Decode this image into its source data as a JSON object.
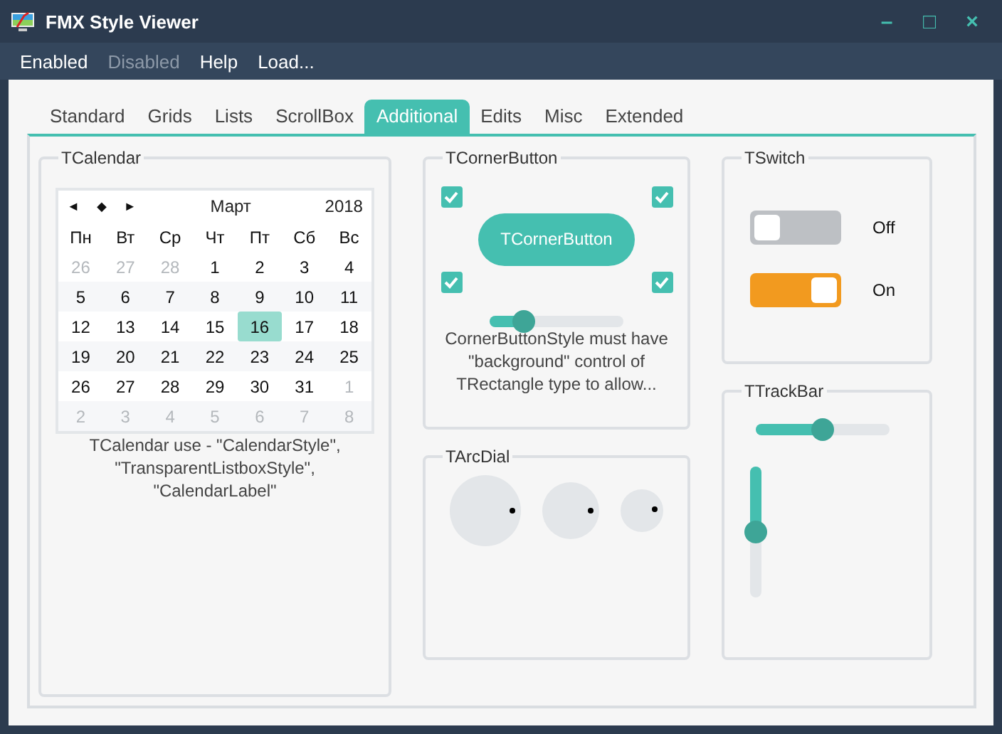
{
  "window": {
    "title": "FMX Style Viewer",
    "controls": [
      "–",
      "□",
      "×"
    ]
  },
  "menu": [
    {
      "label": "Enabled",
      "disabled": false
    },
    {
      "label": "Disabled",
      "disabled": true
    },
    {
      "label": "Help",
      "disabled": false
    },
    {
      "label": "Load...",
      "disabled": false
    }
  ],
  "tabs": [
    {
      "label": "Standard",
      "selected": false
    },
    {
      "label": "Grids",
      "selected": false
    },
    {
      "label": "Lists",
      "selected": false
    },
    {
      "label": "ScrollBox",
      "selected": false
    },
    {
      "label": "Additional",
      "selected": true
    },
    {
      "label": "Edits",
      "selected": false
    },
    {
      "label": "Misc",
      "selected": false
    },
    {
      "label": "Extended",
      "selected": false
    }
  ],
  "calendar": {
    "title": "TCalendar",
    "nav": [
      "◄",
      "◆",
      "►"
    ],
    "month": "Март",
    "year": "2018",
    "weekdays": [
      "Пн",
      "Вт",
      "Ср",
      "Чт",
      "Пт",
      "Сб",
      "Вс"
    ],
    "weeks": [
      [
        {
          "day": "26",
          "muted": true,
          "selected": false
        },
        {
          "day": "27",
          "muted": true,
          "selected": false
        },
        {
          "day": "28",
          "muted": true,
          "selected": false
        },
        {
          "day": "1",
          "muted": false,
          "selected": false
        },
        {
          "day": "2",
          "muted": false,
          "selected": false
        },
        {
          "day": "3",
          "muted": false,
          "selected": false
        },
        {
          "day": "4",
          "muted": false,
          "selected": false
        }
      ],
      [
        {
          "day": "5",
          "muted": false,
          "selected": false
        },
        {
          "day": "6",
          "muted": false,
          "selected": false
        },
        {
          "day": "7",
          "muted": false,
          "selected": false
        },
        {
          "day": "8",
          "muted": false,
          "selected": false
        },
        {
          "day": "9",
          "muted": false,
          "selected": false
        },
        {
          "day": "10",
          "muted": false,
          "selected": false
        },
        {
          "day": "11",
          "muted": false,
          "selected": false
        }
      ],
      [
        {
          "day": "12",
          "muted": false,
          "selected": false
        },
        {
          "day": "13",
          "muted": false,
          "selected": false
        },
        {
          "day": "14",
          "muted": false,
          "selected": false
        },
        {
          "day": "15",
          "muted": false,
          "selected": false
        },
        {
          "day": "16",
          "muted": false,
          "selected": true
        },
        {
          "day": "17",
          "muted": false,
          "selected": false
        },
        {
          "day": "18",
          "muted": false,
          "selected": false
        }
      ],
      [
        {
          "day": "19",
          "muted": false,
          "selected": false
        },
        {
          "day": "20",
          "muted": false,
          "selected": false
        },
        {
          "day": "21",
          "muted": false,
          "selected": false
        },
        {
          "day": "22",
          "muted": false,
          "selected": false
        },
        {
          "day": "23",
          "muted": false,
          "selected": false
        },
        {
          "day": "24",
          "muted": false,
          "selected": false
        },
        {
          "day": "25",
          "muted": false,
          "selected": false
        }
      ],
      [
        {
          "day": "26",
          "muted": false,
          "selected": false
        },
        {
          "day": "27",
          "muted": false,
          "selected": false
        },
        {
          "day": "28",
          "muted": false,
          "selected": false
        },
        {
          "day": "29",
          "muted": false,
          "selected": false
        },
        {
          "day": "30",
          "muted": false,
          "selected": false
        },
        {
          "day": "31",
          "muted": false,
          "selected": false
        },
        {
          "day": "1",
          "muted": true,
          "selected": false
        }
      ],
      [
        {
          "day": "2",
          "muted": true,
          "selected": false
        },
        {
          "day": "3",
          "muted": true,
          "selected": false
        },
        {
          "day": "4",
          "muted": true,
          "selected": false
        },
        {
          "day": "5",
          "muted": true,
          "selected": false
        },
        {
          "day": "6",
          "muted": true,
          "selected": false
        },
        {
          "day": "7",
          "muted": true,
          "selected": false
        },
        {
          "day": "8",
          "muted": true,
          "selected": false
        }
      ]
    ],
    "note": "TCalendar use - \"CalendarStyle\", \"TransparentListboxStyle\", \"CalendarLabel\""
  },
  "corner_button": {
    "title": "TCornerButton",
    "button": "TCornerButton",
    "corners": [
      {
        "checked": true
      },
      {
        "checked": true
      },
      {
        "checked": true
      },
      {
        "checked": true
      }
    ],
    "slider": {
      "level": 0.25
    },
    "note": "CornerButtonStyle must have \"background\" control of TRectangle type to allow..."
  },
  "arc_dial": {
    "title": "TArcDial"
  },
  "switch": {
    "title": "TSwitch",
    "items": [
      {
        "label": "Off",
        "on": false
      },
      {
        "label": "On",
        "on": true
      }
    ]
  },
  "trackbar": {
    "title": "TTrackBar",
    "horizontal": {
      "level": 0.5
    },
    "vertical": {
      "level": 0.5
    }
  }
}
